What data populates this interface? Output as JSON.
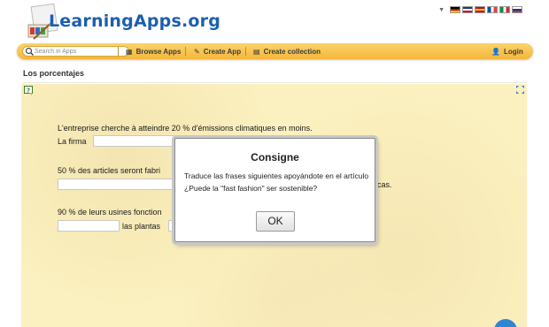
{
  "header": {
    "logo_text": "LearningApps.org",
    "languages": [
      {
        "name": "de",
        "colors": [
          "#000000",
          "#dd0000",
          "#ffce00"
        ]
      },
      {
        "name": "en",
        "colors": [
          "#1a3a8a",
          "#ffffff",
          "#cc1122"
        ]
      },
      {
        "name": "es",
        "colors": [
          "#c60b1e",
          "#ffc400",
          "#c60b1e"
        ]
      },
      {
        "name": "fr",
        "colors": [
          "#0055a4",
          "#ffffff",
          "#ef4135"
        ]
      },
      {
        "name": "it",
        "colors": [
          "#009246",
          "#ffffff",
          "#ce2b37"
        ]
      },
      {
        "name": "ru",
        "colors": [
          "#ffffff",
          "#0039a6",
          "#d52b1e"
        ]
      }
    ]
  },
  "toolbar": {
    "search_placeholder": "Search in Apps",
    "browse_label": "Browse Apps",
    "create_label": "Create App",
    "collection_label": "Create collection",
    "login_label": "Login"
  },
  "page": {
    "title": "Los porcentajes"
  },
  "exercise": {
    "line1": "L'entreprise cherche à atteindre 20 % d'émissions climatiques en moins.",
    "line1_prefix": "La firma",
    "line2": "50 % des articles seront fabri",
    "line2_suffix": "icas.",
    "line3": "90 % de leurs usines fonction",
    "line3_mid": "las plantas"
  },
  "modal": {
    "title": "Consigne",
    "body": "Traduce las frases siguientes apoyándote en el artículo ¿Puede la \"fast fashion\" ser sostenible?",
    "ok_label": "OK"
  },
  "colors": {
    "toolbar": "#f4b63a",
    "stage": "#fbf0bf",
    "logo": "#1c5fb0",
    "chat": "#2f86d6"
  }
}
